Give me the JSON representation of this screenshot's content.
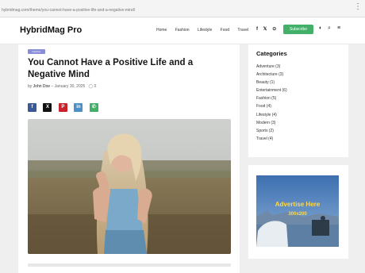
{
  "browser": {
    "url": "hybridmag.com/theme/you-cannot-have-a-positive-life-and-a-negative-mind/"
  },
  "site": {
    "logo": "HybridMag Pro",
    "nav": [
      "Home",
      "Fashion",
      "Lifestyle",
      "Food",
      "Travel"
    ],
    "social": [
      "f",
      "𝕏",
      "⊙"
    ],
    "subscribe_label": "Subscribe",
    "accent": "#43b06a"
  },
  "article": {
    "category": "Fashion",
    "title": "You Cannot Have a Positive Life and a Negative Mind",
    "meta": {
      "by": "by",
      "author": "John Doe",
      "date": "January 30, 2025",
      "comments": "0"
    },
    "share": [
      {
        "icon": "facebook-icon",
        "glyph": "f",
        "color": "#3b5998"
      },
      {
        "icon": "x-icon",
        "glyph": "X",
        "color": "#111111"
      },
      {
        "icon": "pinterest-icon",
        "glyph": "P",
        "color": "#c8232c"
      },
      {
        "icon": "linkedin-icon",
        "glyph": "in",
        "color": "#4a90c9"
      },
      {
        "icon": "whatsapp-icon",
        "glyph": "✆",
        "color": "#43b06a"
      }
    ]
  },
  "sidebar": {
    "categories_title": "Categories",
    "categories": [
      "Adventure (3)",
      "Architecture (3)",
      "Beauty (1)",
      "Entertainment (6)",
      "Fashion (5)",
      "Food (4)",
      "Lifestyle (4)",
      "Modern (3)",
      "Sports (2)",
      "Travel (4)"
    ],
    "ad": {
      "title": "Advertise Here",
      "size": "300x200"
    }
  }
}
